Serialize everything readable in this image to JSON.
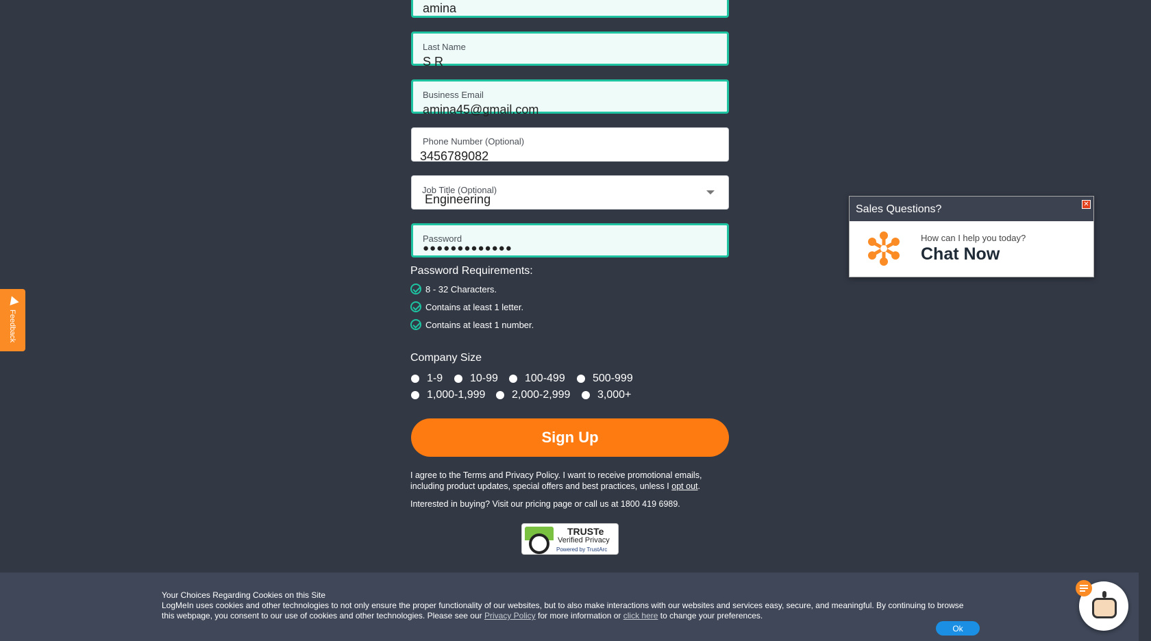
{
  "form": {
    "first_name_value": "amina",
    "last_name_label": "Last Name",
    "last_name_value": "S R",
    "email_label": "Business Email",
    "email_value": "amina45@gmail.com",
    "phone_label": "Phone Number (Optional)",
    "phone_value": "3456789082",
    "job_label": "Job Title (Optional)",
    "job_value": "Engineering",
    "password_label": "Password",
    "password_value": "●●●●●●●●●●●●●"
  },
  "password_requirements": {
    "title": "Password Requirements:",
    "items": [
      "8 - 32 Characters.",
      "Contains at least 1 letter.",
      "Contains at least 1 number."
    ]
  },
  "company_size": {
    "title": "Company Size",
    "options": [
      "1-9",
      "10-99",
      "100-499",
      "500-999",
      "1,000-1,999",
      "2,000-2,999",
      "3,000+"
    ]
  },
  "signup_label": "Sign Up",
  "legal": {
    "agree_text": "I agree to the Terms and Privacy Policy. I want to receive promotional emails, including product updates, special offers and best practices, unless I",
    "opt_out": "opt out",
    "pricing_text": "Interested in buying? Visit our pricing page or call us at 1800 419 6989."
  },
  "truste": {
    "title": "TRUSTe",
    "subtitle": "Verified Privacy",
    "powered": "Powered by TrustArc"
  },
  "feedback_label": "Feedback",
  "sales_chat": {
    "header": "Sales Questions?",
    "close": "✕",
    "question": "How can I help you today?",
    "cta": "Chat Now"
  },
  "cookie": {
    "title": "Your Choices Regarding Cookies on this Site",
    "body_1": "LogMeIn uses cookies and other technologies to not only ensure the proper functionality of our websites, but to also make interactions with our websites and services easy, secure, and meaningful. By continuing to browse this webpage, you consent to our use of cookies and other technologies. Please see our",
    "privacy_link": "Privacy Policy",
    "body_2": "for more information or",
    "click_here": "click here",
    "body_3": "to change your preferences.",
    "ok": "Ok"
  },
  "colors": {
    "accent": "#fe7b12",
    "valid": "#1ec4a2",
    "background": "#323844"
  },
  "icons": [
    "check-circle-icon",
    "dropdown-caret-icon",
    "feedback-pointer-icon",
    "close-icon",
    "chat-star-icon",
    "chatbot-icon",
    "message-badge-icon"
  ]
}
